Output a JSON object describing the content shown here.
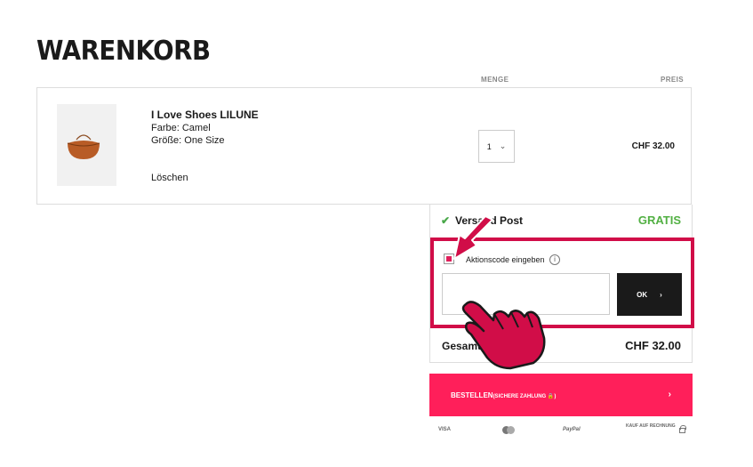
{
  "page": {
    "title": "WARENKORB"
  },
  "columns": {
    "quantity": "MENGE",
    "price": "PREIS"
  },
  "item": {
    "name": "I Love Shoes LILUNE",
    "color": "Farbe: Camel",
    "size": "Größe: One Size",
    "remove": "Löschen",
    "quantity": "1",
    "price": "CHF 32.00"
  },
  "shipping": {
    "check": "✔",
    "label": "Versand Post",
    "value": "GRATIS"
  },
  "promo": {
    "label": "Aktionscode eingeben",
    "info": "i",
    "input_value": "",
    "ok_label": "OK",
    "ok_chevron": "›"
  },
  "total": {
    "label": "Gesamt",
    "value": "CHF 32.00"
  },
  "order": {
    "label": "BESTELLEN",
    "sub": "(SICHERE ZAHLUNG 🔒)",
    "chevron": "›"
  },
  "payment": {
    "visa": "VISA",
    "paypal": "PayPal",
    "invoice": "KAUF AUF RECHNUNG"
  },
  "colors": {
    "accent": "#ff1f5a",
    "annotation": "#d10d48",
    "success": "#52b043"
  },
  "icons": [
    "bag-icon",
    "chevron-down-icon",
    "check-icon",
    "info-icon",
    "chevron-right-icon",
    "lock-icon",
    "arrow-annotation",
    "hand-pointer-annotation"
  ]
}
